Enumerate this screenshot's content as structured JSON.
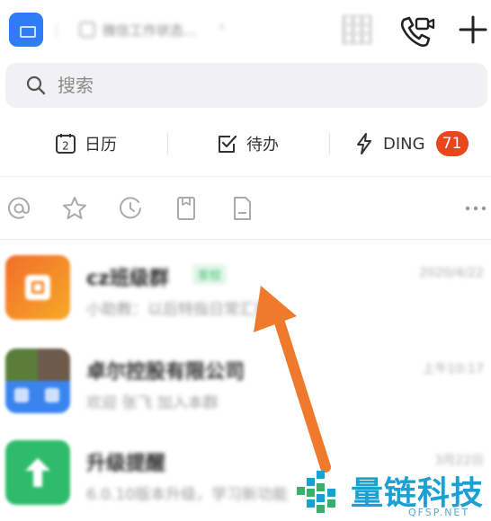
{
  "header": {
    "org_name": "微信工作状态...",
    "icons": [
      "app-logo",
      "qr-code-icon",
      "phone-video-call-icon",
      "plus-icon"
    ]
  },
  "search": {
    "placeholder": "搜索"
  },
  "quick_actions": {
    "calendar": {
      "label": "日历",
      "icon_number": "2"
    },
    "todo": {
      "label": "待办"
    },
    "ding": {
      "label": "DING",
      "badge": "71"
    }
  },
  "filters": [
    "at-icon",
    "star-icon",
    "clock-icon",
    "bookmark-icon",
    "document-icon",
    "more-icon"
  ],
  "chats": [
    {
      "title": "cz班级群",
      "tag": "家校",
      "preview": "小助教：以后特指日常汇报",
      "time": "2020/4/22",
      "avatar_color": "#f7941d"
    },
    {
      "title": "卓尔控股有限公司",
      "tag": "",
      "preview": "欢迎 张飞 加入本群",
      "time": "上午10:17",
      "avatar_color": "#3a84f0"
    },
    {
      "title": "升级提醒",
      "tag": "",
      "preview": "6.0.10版本升级，学习新功能",
      "time": "3月22日",
      "avatar_color": "#2ebc6a"
    }
  ],
  "watermark": {
    "text": "量链科技",
    "sub": "QFSP.NET"
  },
  "colors": {
    "accent": "#2f7cf6",
    "badge": "#e8471d",
    "arrow": "#f07a2c",
    "watermark": "#1aa0d2"
  }
}
